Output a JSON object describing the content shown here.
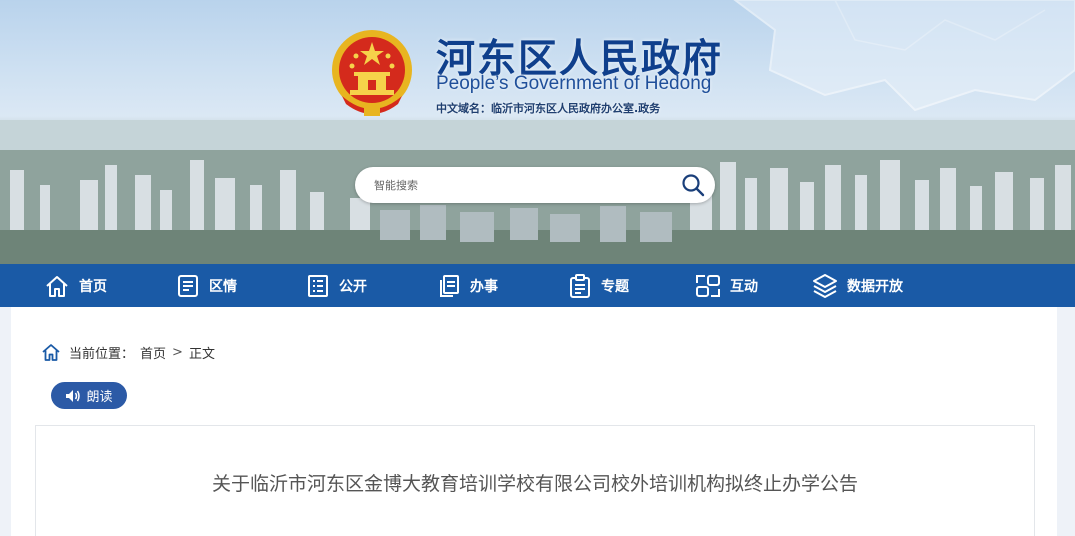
{
  "header": {
    "title": "河东区人民政府",
    "subtitle": "People’s Government of Hedong",
    "domain_line": "中文域名：临沂市河东区人民政府办公室.政务",
    "emblem_icon": "national-emblem-icon"
  },
  "search": {
    "placeholder": "智能搜索",
    "value": "",
    "button_icon": "search-icon"
  },
  "nav": {
    "items": [
      {
        "label": "首页",
        "icon": "home-icon"
      },
      {
        "label": "区情",
        "icon": "document-icon"
      },
      {
        "label": "公开",
        "icon": "list-document-icon"
      },
      {
        "label": "办事",
        "icon": "files-icon"
      },
      {
        "label": "专题",
        "icon": "clipboard-icon"
      },
      {
        "label": "互动",
        "icon": "interaction-icon"
      },
      {
        "label": "数据开放",
        "icon": "layers-icon"
      }
    ]
  },
  "breadcrumb": {
    "prefix": "当前位置：",
    "items": [
      "首页",
      "正文"
    ],
    "separator": ">"
  },
  "read_button": {
    "label": "朗读",
    "icon": "speaker-icon"
  },
  "article": {
    "title": "关于临沂市河东区金博大教育培训学校有限公司校外培训机构拟终止办学公告"
  },
  "colors": {
    "nav_bg": "#1a5aa6",
    "title_blue": "#0f3f8c",
    "read_btn": "#2c5aa6"
  }
}
